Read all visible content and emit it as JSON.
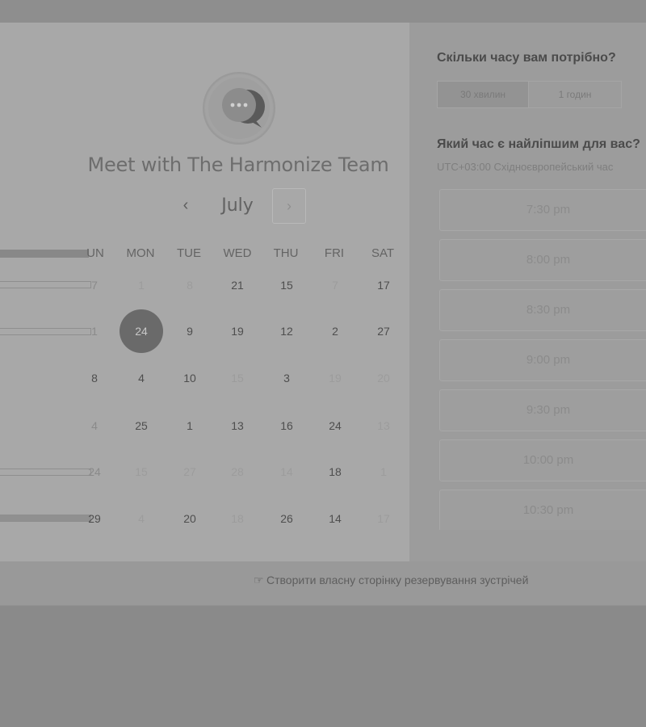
{
  "header": {
    "title": "Meet with The Harmonize Team",
    "avatar_icon": "chat-bubble-icon"
  },
  "calendar": {
    "month": "July",
    "prev_label": "‹",
    "next_label": "›",
    "weekdays": [
      "UN",
      "MON",
      "TUE",
      "WED",
      "THU",
      "FRI",
      "SAT"
    ],
    "weeks": [
      [
        {
          "t": "7",
          "s": "cut"
        },
        {
          "t": "1",
          "s": "dim"
        },
        {
          "t": "8",
          "s": "dim"
        },
        {
          "t": "21",
          "s": "avail"
        },
        {
          "t": "15",
          "s": "avail"
        },
        {
          "t": "7",
          "s": "dim"
        },
        {
          "t": "17",
          "s": "avail"
        }
      ],
      [
        {
          "t": "1",
          "s": "cut"
        },
        {
          "t": "24",
          "s": "sel"
        },
        {
          "t": "9",
          "s": "avail"
        },
        {
          "t": "19",
          "s": "avail"
        },
        {
          "t": "12",
          "s": "avail"
        },
        {
          "t": "2",
          "s": "avail"
        },
        {
          "t": "27",
          "s": "avail"
        }
      ],
      [
        {
          "t": "8",
          "s": "cutdark"
        },
        {
          "t": "4",
          "s": "avail"
        },
        {
          "t": "10",
          "s": "avail"
        },
        {
          "t": "15",
          "s": "dim"
        },
        {
          "t": "3",
          "s": "avail"
        },
        {
          "t": "19",
          "s": "dim"
        },
        {
          "t": "20",
          "s": "dim"
        }
      ],
      [
        {
          "t": "4",
          "s": "cut"
        },
        {
          "t": "25",
          "s": "avail"
        },
        {
          "t": "1",
          "s": "avail"
        },
        {
          "t": "13",
          "s": "avail"
        },
        {
          "t": "16",
          "s": "avail"
        },
        {
          "t": "24",
          "s": "avail"
        },
        {
          "t": "13",
          "s": "dim"
        }
      ],
      [
        {
          "t": "24",
          "s": "cut"
        },
        {
          "t": "15",
          "s": "dim"
        },
        {
          "t": "27",
          "s": "dim"
        },
        {
          "t": "28",
          "s": "dim"
        },
        {
          "t": "14",
          "s": "dim"
        },
        {
          "t": "18",
          "s": "avail"
        },
        {
          "t": "1",
          "s": "dim"
        }
      ],
      [
        {
          "t": "29",
          "s": "cutdark"
        },
        {
          "t": "4",
          "s": "dim"
        },
        {
          "t": "20",
          "s": "avail"
        },
        {
          "t": "18",
          "s": "dim"
        },
        {
          "t": "26",
          "s": "avail"
        },
        {
          "t": "14",
          "s": "avail"
        },
        {
          "t": "17",
          "s": "dim"
        }
      ]
    ]
  },
  "booking": {
    "duration_question": "Скільки часу вам потрібно?",
    "durations": [
      "30 хвилин",
      "1 годин"
    ],
    "time_question": "Який час є найліпшим для вас?",
    "timezone": "UTC+03:00 Східноєвропейський час",
    "slots": [
      "7:30 pm",
      "8:00 pm",
      "8:30 pm",
      "9:00 pm",
      "9:30 pm",
      "10:00 pm",
      "10:30 pm"
    ]
  },
  "footer": {
    "link_icon": "cursor-hand-icon",
    "link_text": "Створити власну сторінку резервування зустрічей"
  }
}
